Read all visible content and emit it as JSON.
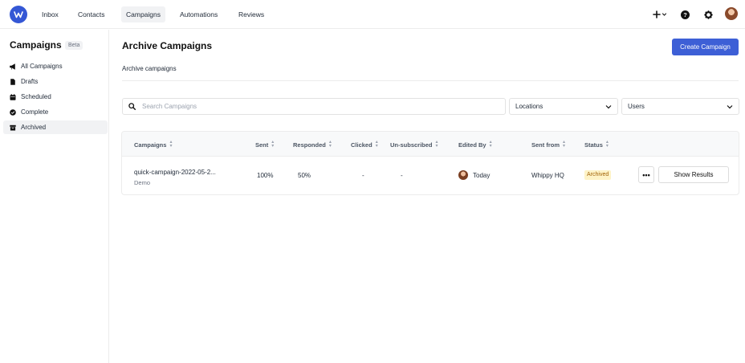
{
  "nav": {
    "items": [
      "Inbox",
      "Contacts",
      "Campaigns",
      "Automations",
      "Reviews"
    ],
    "active": "Campaigns"
  },
  "sidebar": {
    "title": "Campaigns",
    "badge": "Beta",
    "items": [
      {
        "label": "All Campaigns",
        "icon": "megaphone-icon"
      },
      {
        "label": "Drafts",
        "icon": "document-icon"
      },
      {
        "label": "Scheduled",
        "icon": "calendar-icon"
      },
      {
        "label": "Complete",
        "icon": "check-circle-icon"
      },
      {
        "label": "Archived",
        "icon": "archive-icon"
      }
    ],
    "active": "Archived"
  },
  "main": {
    "title": "Archive Campaigns",
    "subtitle": "Archive campaigns",
    "create_button": "Create Campaign",
    "search_placeholder": "Search Campaigns",
    "locations_select": "Locations",
    "users_select": "Users"
  },
  "table": {
    "headers": [
      "Campaigns",
      "Sent",
      "Responded",
      "Clicked",
      "Un-subscribed",
      "Edited By",
      "Sent from",
      "Status"
    ],
    "rows": [
      {
        "name": "quick-campaign-2022-05-2...",
        "location": "Demo",
        "sent": "100%",
        "responded": "50%",
        "clicked": "-",
        "unsubscribed": "-",
        "edited_by": "Today",
        "sent_from": "Whippy HQ",
        "status": "Archived",
        "more": "•••",
        "action": "Show Results"
      }
    ]
  },
  "colors": {
    "brand": "#3457d5",
    "primary_button": "#3d5fd6",
    "archived_badge_bg": "#fef3c7",
    "archived_badge_text": "#a16207"
  }
}
